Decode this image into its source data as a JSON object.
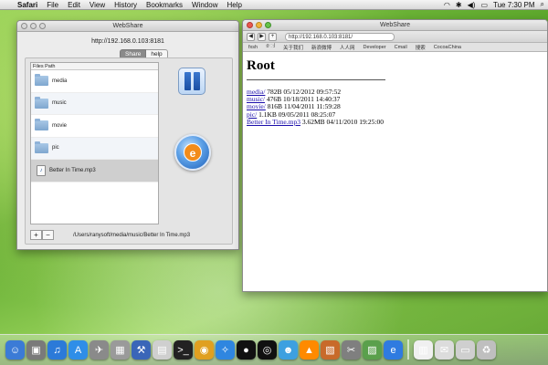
{
  "menubar": {
    "apple_glyph": "",
    "items": [
      "Safari",
      "File",
      "Edit",
      "View",
      "History",
      "Bookmarks",
      "Window",
      "Help"
    ],
    "clock": "Tue 7:30 PM"
  },
  "webshare": {
    "title": "WebShare",
    "url": "http://192.168.0.103:8181",
    "tabs": [
      "Share",
      "help"
    ],
    "list_header": "Files Path",
    "files": [
      {
        "name": "media",
        "type": "folder"
      },
      {
        "name": "music",
        "type": "folder"
      },
      {
        "name": "movie",
        "type": "folder"
      },
      {
        "name": "pic",
        "type": "folder"
      },
      {
        "name": "Better In Time.mp3",
        "type": "file"
      }
    ],
    "add_label": "+",
    "remove_label": "−",
    "current_path": "/Users/ranysoft/media/music/Better In Time.mp3"
  },
  "browser": {
    "title": "WebShare",
    "back_glyph": "◀",
    "forward_glyph": "▶",
    "add_glyph": "+",
    "url": "http://192.168.0.103:8181/",
    "bookmarks": [
      "fxsh",
      "ෝ",
      "关于我们",
      "新浪微博",
      "人人网",
      "Developer",
      "Cmail",
      "搜索",
      "CocoaChina"
    ],
    "heading": "Root",
    "entries": [
      {
        "link": "media/",
        "info": "782B 05/12/2012 09:57:52"
      },
      {
        "link": "music/",
        "info": "476B 10/18/2011 14:40:37"
      },
      {
        "link": "movie/",
        "info": "816B 11/04/2011 11:59:28"
      },
      {
        "link": "pic/",
        "info": "1.1KB 09/05/2011 08:25:07"
      },
      {
        "link": "Better In Time.mp3",
        "info": "3.62MB 04/11/2010 19:25:00"
      }
    ]
  },
  "dock": {
    "icons": [
      "finder-icon",
      "screenshot-icon",
      "itunes-icon",
      "app-store-icon",
      "launchpad-icon",
      "calculator-icon",
      "xcode-icon",
      "preview-icon",
      "terminal-icon",
      "chrome-icon",
      "safari-icon",
      "qq-icon",
      "camera-icon",
      "people-icon",
      "vlc-icon",
      "photo-icon",
      "tools-icon",
      "image-icon",
      "webshare-icon",
      "document-icon",
      "mail-icon",
      "display-icon",
      "trash-icon"
    ],
    "colors": [
      "#3b7bd6",
      "#7a7a7a",
      "#2c7ad8",
      "#2f8ee8",
      "#8a8a8a",
      "#9a9a9a",
      "#3a66b8",
      "#cfcfcf",
      "#222222",
      "#e0a020",
      "#2f86e0",
      "#111111",
      "#101010",
      "#3da0e0",
      "#ff8a00",
      "#c86a2a",
      "#7f7f7f",
      "#5aa04c",
      "#2f7be0",
      "#f0f0f0",
      "#dcdcdc",
      "#cfcfcf",
      "#bfbfbf"
    ]
  }
}
